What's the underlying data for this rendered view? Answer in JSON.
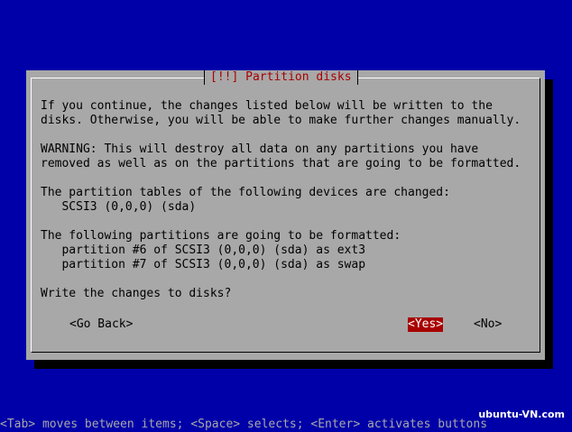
{
  "dialog": {
    "title": "[!!] Partition disks",
    "lines": [
      "If you continue, the changes listed below will be written to the",
      "disks. Otherwise, you will be able to make further changes manually.",
      "WARNING: This will destroy all data on any partitions you have",
      "removed as well as on the partitions that are going to be formatted.",
      "The partition tables of the following devices are changed:",
      "   SCSI3 (0,0,0) (sda)",
      "The following partitions are going to be formatted:",
      "   partition #6 of SCSI3 (0,0,0) (sda) as ext3",
      "   partition #7 of SCSI3 (0,0,0) (sda) as swap",
      "Write the changes to disks?"
    ],
    "buttons": {
      "go_back": "<Go Back>",
      "yes": "<Yes>",
      "no": "<No>"
    }
  },
  "help_bar": "<Tab> moves between items; <Space> selects; <Enter> activates buttons",
  "watermark": "ubuntu-VN.com",
  "colors": {
    "background": "#0000a8",
    "dialog": "#a8a8a8",
    "title": "#a80000",
    "selected_button": "#a80000"
  }
}
